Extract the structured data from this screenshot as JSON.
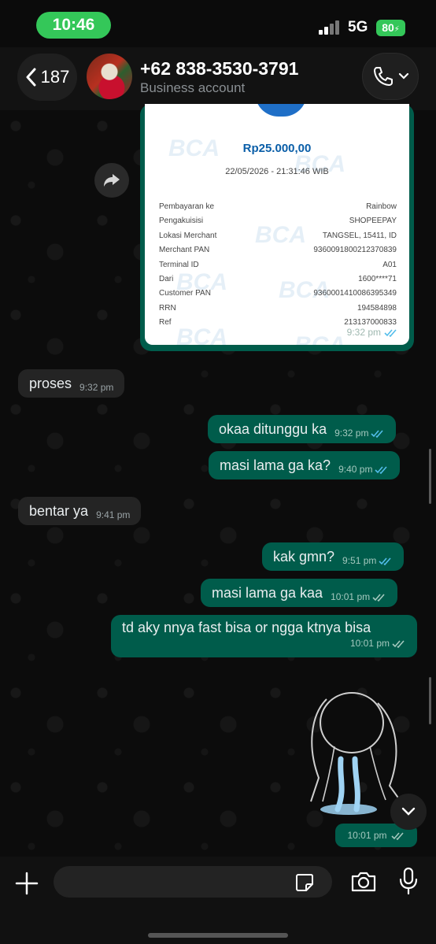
{
  "status_bar": {
    "time": "10:46",
    "network": "5G",
    "battery": "80"
  },
  "header": {
    "back_count": "187",
    "contact_name": "+62 838-3530-3791",
    "contact_subtitle": "Business account"
  },
  "receipt": {
    "amount": "Rp25.000,00",
    "datetime": "22/05/2026 - 21:31:46 WIB",
    "rows": [
      {
        "label": "Pembayaran ke",
        "value": "Rainbow"
      },
      {
        "label": "Pengakuisisi",
        "value": "SHOPEEPAY"
      },
      {
        "label": "Lokasi Merchant",
        "value": "TANGSEL, 15411, ID"
      },
      {
        "label": "Merchant PAN",
        "value": "9360091800212370839"
      },
      {
        "label": "Terminal ID",
        "value": "A01"
      },
      {
        "label": "Dari",
        "value": "1600****71"
      },
      {
        "label": "Customer PAN",
        "value": "9360001410086395349"
      },
      {
        "label": "RRN",
        "value": "194584898"
      },
      {
        "label": "Ref",
        "value": "213137000833"
      }
    ],
    "time": "9:32 pm"
  },
  "messages": [
    {
      "direction": "in",
      "text": "proses",
      "time": "9:32 pm"
    },
    {
      "direction": "out",
      "text": "okaa ditunggu ka",
      "time": "9:32 pm"
    },
    {
      "direction": "out",
      "text": "masi lama ga ka?",
      "time": "9:40 pm"
    },
    {
      "direction": "in",
      "text": "bentar ya",
      "time": "9:41 pm"
    },
    {
      "direction": "out",
      "text": "kak gmn?",
      "time": "9:51 pm"
    },
    {
      "direction": "out",
      "text": "masi lama ga kaa",
      "time": "10:01 pm"
    },
    {
      "direction": "out",
      "text": "td aky nnya fast bisa or ngga ktnya bisa",
      "time": "10:01 pm"
    }
  ],
  "sticker": {
    "time": "10:01 pm"
  },
  "composer": {
    "placeholder": ""
  },
  "colors": {
    "outgoing_bubble": "#005c4b",
    "incoming_bubble": "#242424",
    "status_green": "#34c759",
    "read_tick_blue": "#53bdeb"
  },
  "icons": {
    "back": "chevron-left-icon",
    "call": "phone-icon",
    "forward": "forward-icon",
    "read": "double-check-icon",
    "scroll": "chevron-down-icon",
    "plus": "plus-icon",
    "sticker": "sticker-icon",
    "camera": "camera-icon",
    "mic": "microphone-icon"
  }
}
